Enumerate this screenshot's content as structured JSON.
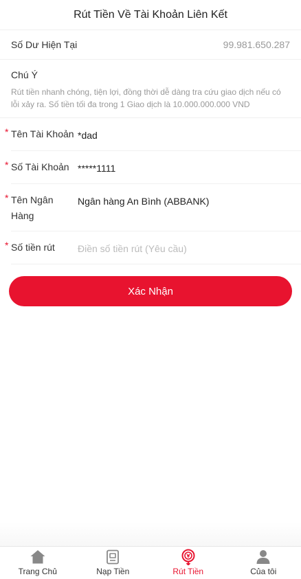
{
  "header": {
    "title": "Rút Tiền Về Tài Khoản Liên Kết"
  },
  "balance": {
    "label": "Số Dư Hiện Tại",
    "value": "99.981.650.287"
  },
  "note": {
    "title": "Chú Ý",
    "text": "Rút tiền nhanh chóng, tiện lợi, đồng thời dễ dàng tra cứu giao dịch nếu có lỗi xảy ra. Số tiền tối đa trong 1 Giao dịch là 10.000.000.000 VND"
  },
  "form": {
    "required_mark": "*",
    "account_name": {
      "label": "Tên Tài Khoản",
      "value": "*dad"
    },
    "account_number": {
      "label": "Số Tài Khoản",
      "value": "*****1111"
    },
    "bank_name": {
      "label": "Tên Ngân Hàng",
      "value": "Ngân hàng An Bình (ABBANK)"
    },
    "amount": {
      "label": "Số tiền rút",
      "value": "",
      "placeholder": "Điền số tiền rút (Yêu cầu)"
    }
  },
  "submit": {
    "label": "Xác Nhận"
  },
  "tabbar": {
    "items": [
      {
        "label": "Trang Chủ",
        "icon": "home-icon"
      },
      {
        "label": "Nạp Tiền",
        "icon": "deposit-icon"
      },
      {
        "label": "Rút Tiền",
        "icon": "withdraw-icon",
        "active": true
      },
      {
        "label": "Của tôi",
        "icon": "user-icon"
      }
    ]
  },
  "colors": {
    "accent": "#e8132f",
    "inactive_icon": "#888888",
    "muted_text": "#999999"
  }
}
